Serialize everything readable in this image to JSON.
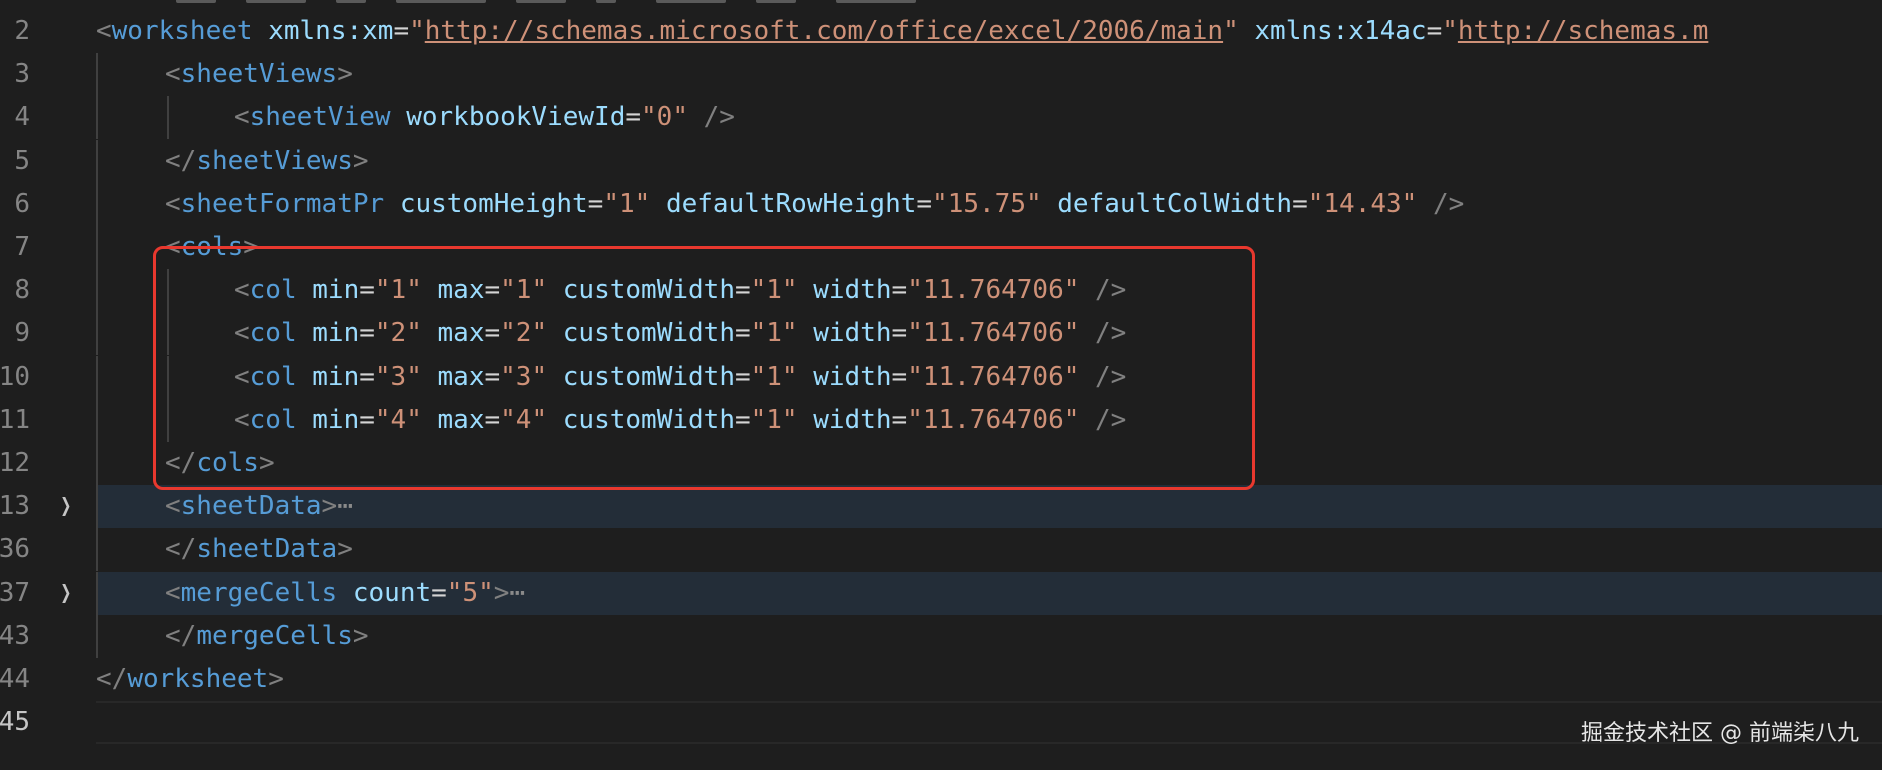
{
  "editor": {
    "line_numbers": [
      "2",
      "3",
      "4",
      "5",
      "6",
      "7",
      "8",
      "9",
      "10",
      "11",
      "12",
      "13",
      "36",
      "37",
      "43",
      "44",
      "45"
    ],
    "colors": {
      "background": "#1e1e1e",
      "tag": "#569cd6",
      "attribute": "#9cdcfe",
      "value": "#ce9178",
      "bracket": "#808080",
      "highlight_box": "#e8382e"
    },
    "lines": [
      {
        "ln": "2",
        "indent": 0,
        "tokens": [
          {
            "t": "<",
            "c": "b"
          },
          {
            "t": "worksheet",
            "c": "tag"
          },
          {
            "t": " ",
            "c": "eq"
          },
          {
            "t": "xmlns:xm",
            "c": "attr"
          },
          {
            "t": "=",
            "c": "eq"
          },
          {
            "t": "\"",
            "c": "val"
          },
          {
            "t": "http://schemas.microsoft.com/office/excel/2006/main",
            "c": "url"
          },
          {
            "t": "\"",
            "c": "val"
          },
          {
            "t": " ",
            "c": "eq"
          },
          {
            "t": "xmlns:x14ac",
            "c": "attr"
          },
          {
            "t": "=",
            "c": "eq"
          },
          {
            "t": "\"",
            "c": "val"
          },
          {
            "t": "http://schemas.m",
            "c": "url"
          }
        ]
      },
      {
        "ln": "3",
        "indent": 1,
        "tokens": [
          {
            "t": "<",
            "c": "b"
          },
          {
            "t": "sheetViews",
            "c": "tag"
          },
          {
            "t": ">",
            "c": "b"
          }
        ]
      },
      {
        "ln": "4",
        "indent": 2,
        "tokens": [
          {
            "t": "<",
            "c": "b"
          },
          {
            "t": "sheetView",
            "c": "tag"
          },
          {
            "t": " ",
            "c": "eq"
          },
          {
            "t": "workbookViewId",
            "c": "attr"
          },
          {
            "t": "=",
            "c": "eq"
          },
          {
            "t": "\"0\"",
            "c": "val"
          },
          {
            "t": " />",
            "c": "b"
          }
        ]
      },
      {
        "ln": "5",
        "indent": 1,
        "tokens": [
          {
            "t": "</",
            "c": "b"
          },
          {
            "t": "sheetViews",
            "c": "tag"
          },
          {
            "t": ">",
            "c": "b"
          }
        ]
      },
      {
        "ln": "6",
        "indent": 1,
        "tokens": [
          {
            "t": "<",
            "c": "b"
          },
          {
            "t": "sheetFormatPr",
            "c": "tag"
          },
          {
            "t": " ",
            "c": "eq"
          },
          {
            "t": "customHeight",
            "c": "attr"
          },
          {
            "t": "=",
            "c": "eq"
          },
          {
            "t": "\"1\"",
            "c": "val"
          },
          {
            "t": " ",
            "c": "eq"
          },
          {
            "t": "defaultRowHeight",
            "c": "attr"
          },
          {
            "t": "=",
            "c": "eq"
          },
          {
            "t": "\"15.75\"",
            "c": "val"
          },
          {
            "t": " ",
            "c": "eq"
          },
          {
            "t": "defaultColWidth",
            "c": "attr"
          },
          {
            "t": "=",
            "c": "eq"
          },
          {
            "t": "\"14.43\"",
            "c": "val"
          },
          {
            "t": " />",
            "c": "b"
          }
        ]
      },
      {
        "ln": "7",
        "indent": 1,
        "tokens": [
          {
            "t": "<",
            "c": "b"
          },
          {
            "t": "cols",
            "c": "tag"
          },
          {
            "t": ">",
            "c": "b"
          }
        ]
      },
      {
        "ln": "8",
        "indent": 2,
        "tokens": [
          {
            "t": "<",
            "c": "b"
          },
          {
            "t": "col",
            "c": "tag"
          },
          {
            "t": " ",
            "c": "eq"
          },
          {
            "t": "min",
            "c": "attr"
          },
          {
            "t": "=",
            "c": "eq"
          },
          {
            "t": "\"1\"",
            "c": "val"
          },
          {
            "t": " ",
            "c": "eq"
          },
          {
            "t": "max",
            "c": "attr"
          },
          {
            "t": "=",
            "c": "eq"
          },
          {
            "t": "\"1\"",
            "c": "val"
          },
          {
            "t": " ",
            "c": "eq"
          },
          {
            "t": "customWidth",
            "c": "attr"
          },
          {
            "t": "=",
            "c": "eq"
          },
          {
            "t": "\"1\"",
            "c": "val"
          },
          {
            "t": " ",
            "c": "eq"
          },
          {
            "t": "width",
            "c": "attr"
          },
          {
            "t": "=",
            "c": "eq"
          },
          {
            "t": "\"11.764706\"",
            "c": "val"
          },
          {
            "t": " />",
            "c": "b"
          }
        ]
      },
      {
        "ln": "9",
        "indent": 2,
        "tokens": [
          {
            "t": "<",
            "c": "b"
          },
          {
            "t": "col",
            "c": "tag"
          },
          {
            "t": " ",
            "c": "eq"
          },
          {
            "t": "min",
            "c": "attr"
          },
          {
            "t": "=",
            "c": "eq"
          },
          {
            "t": "\"2\"",
            "c": "val"
          },
          {
            "t": " ",
            "c": "eq"
          },
          {
            "t": "max",
            "c": "attr"
          },
          {
            "t": "=",
            "c": "eq"
          },
          {
            "t": "\"2\"",
            "c": "val"
          },
          {
            "t": " ",
            "c": "eq"
          },
          {
            "t": "customWidth",
            "c": "attr"
          },
          {
            "t": "=",
            "c": "eq"
          },
          {
            "t": "\"1\"",
            "c": "val"
          },
          {
            "t": " ",
            "c": "eq"
          },
          {
            "t": "width",
            "c": "attr"
          },
          {
            "t": "=",
            "c": "eq"
          },
          {
            "t": "\"11.764706\"",
            "c": "val"
          },
          {
            "t": " />",
            "c": "b"
          }
        ]
      },
      {
        "ln": "10",
        "indent": 2,
        "tokens": [
          {
            "t": "<",
            "c": "b"
          },
          {
            "t": "col",
            "c": "tag"
          },
          {
            "t": " ",
            "c": "eq"
          },
          {
            "t": "min",
            "c": "attr"
          },
          {
            "t": "=",
            "c": "eq"
          },
          {
            "t": "\"3\"",
            "c": "val"
          },
          {
            "t": " ",
            "c": "eq"
          },
          {
            "t": "max",
            "c": "attr"
          },
          {
            "t": "=",
            "c": "eq"
          },
          {
            "t": "\"3\"",
            "c": "val"
          },
          {
            "t": " ",
            "c": "eq"
          },
          {
            "t": "customWidth",
            "c": "attr"
          },
          {
            "t": "=",
            "c": "eq"
          },
          {
            "t": "\"1\"",
            "c": "val"
          },
          {
            "t": " ",
            "c": "eq"
          },
          {
            "t": "width",
            "c": "attr"
          },
          {
            "t": "=",
            "c": "eq"
          },
          {
            "t": "\"11.764706\"",
            "c": "val"
          },
          {
            "t": " />",
            "c": "b"
          }
        ]
      },
      {
        "ln": "11",
        "indent": 2,
        "tokens": [
          {
            "t": "<",
            "c": "b"
          },
          {
            "t": "col",
            "c": "tag"
          },
          {
            "t": " ",
            "c": "eq"
          },
          {
            "t": "min",
            "c": "attr"
          },
          {
            "t": "=",
            "c": "eq"
          },
          {
            "t": "\"4\"",
            "c": "val"
          },
          {
            "t": " ",
            "c": "eq"
          },
          {
            "t": "max",
            "c": "attr"
          },
          {
            "t": "=",
            "c": "eq"
          },
          {
            "t": "\"4\"",
            "c": "val"
          },
          {
            "t": " ",
            "c": "eq"
          },
          {
            "t": "customWidth",
            "c": "attr"
          },
          {
            "t": "=",
            "c": "eq"
          },
          {
            "t": "\"1\"",
            "c": "val"
          },
          {
            "t": " ",
            "c": "eq"
          },
          {
            "t": "width",
            "c": "attr"
          },
          {
            "t": "=",
            "c": "eq"
          },
          {
            "t": "\"11.764706\"",
            "c": "val"
          },
          {
            "t": " />",
            "c": "b"
          }
        ]
      },
      {
        "ln": "12",
        "indent": 1,
        "tokens": [
          {
            "t": "</",
            "c": "b"
          },
          {
            "t": "cols",
            "c": "tag"
          },
          {
            "t": ">",
            "c": "b"
          }
        ]
      },
      {
        "ln": "13",
        "indent": 1,
        "fold": true,
        "hl": true,
        "tokens": [
          {
            "t": "<",
            "c": "b"
          },
          {
            "t": "sheetData",
            "c": "tag"
          },
          {
            "t": ">",
            "c": "b"
          },
          {
            "t": "⋯",
            "c": "dots"
          }
        ]
      },
      {
        "ln": "36",
        "indent": 1,
        "tokens": [
          {
            "t": "</",
            "c": "b"
          },
          {
            "t": "sheetData",
            "c": "tag"
          },
          {
            "t": ">",
            "c": "b"
          }
        ]
      },
      {
        "ln": "37",
        "indent": 1,
        "fold": true,
        "hl": true,
        "tokens": [
          {
            "t": "<",
            "c": "b"
          },
          {
            "t": "mergeCells",
            "c": "tag"
          },
          {
            "t": " ",
            "c": "eq"
          },
          {
            "t": "count",
            "c": "attr"
          },
          {
            "t": "=",
            "c": "eq"
          },
          {
            "t": "\"5\"",
            "c": "val"
          },
          {
            "t": ">",
            "c": "b"
          },
          {
            "t": "⋯",
            "c": "dots"
          }
        ]
      },
      {
        "ln": "43",
        "indent": 1,
        "tokens": [
          {
            "t": "</",
            "c": "b"
          },
          {
            "t": "mergeCells",
            "c": "tag"
          },
          {
            "t": ">",
            "c": "b"
          }
        ]
      },
      {
        "ln": "44",
        "indent": 0,
        "tokens": [
          {
            "t": "</",
            "c": "b"
          },
          {
            "t": "worksheet",
            "c": "tag"
          },
          {
            "t": ">",
            "c": "b"
          }
        ]
      },
      {
        "ln": "45",
        "indent": 0,
        "cur": true,
        "tokens": []
      }
    ]
  },
  "watermark": "掘金技术社区 @ 前端柒八九"
}
